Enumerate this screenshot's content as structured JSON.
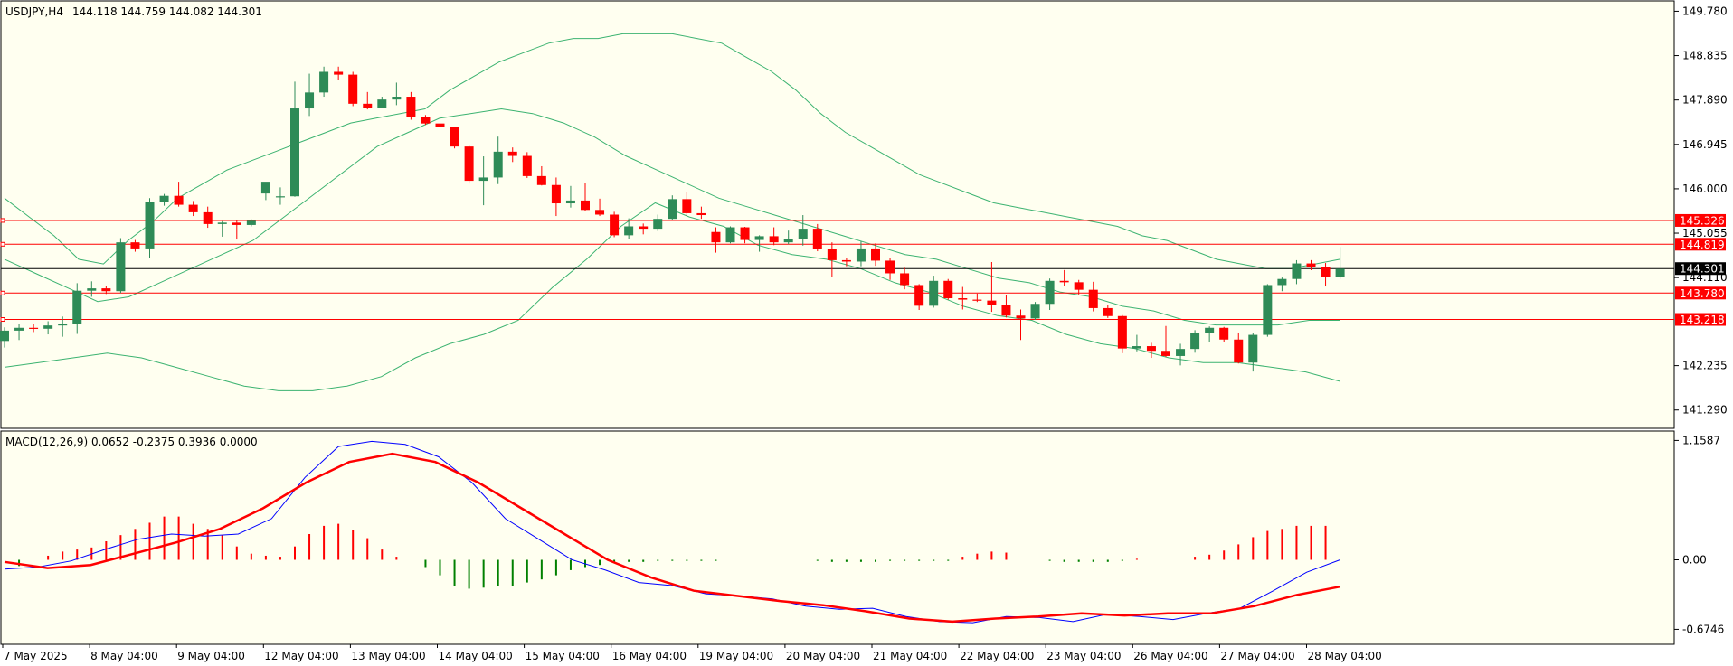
{
  "header": {
    "symbol": "USDJPY,H4",
    "ohlc": "144.118 144.759 144.082 144.301"
  },
  "macd_header": {
    "label": "MACD(12,26,9) 0.0652 -0.2375 0.3936 0.0000"
  },
  "colors": {
    "background": "#fffff0",
    "bull": "#2e8b57",
    "bear": "#ff0000",
    "band": "#3cb371",
    "hline": "#ff0000",
    "price_line": "#000000",
    "macd_line": "#0000ff",
    "signal_line": "#ff0000",
    "hist_pos": "#ff0000",
    "hist_neg": "#008000"
  },
  "chart_data": [
    {
      "type": "candlestick",
      "title": "USDJPY,H4",
      "ylim": [
        140.9,
        150.0
      ],
      "y_ticks": [
        "149.780",
        "148.835",
        "147.890",
        "146.945",
        "146.000",
        "145.055",
        "144.110",
        "142.235",
        "141.290"
      ],
      "x_ticks": [
        "7 May 2025",
        "8 May 04:00",
        "9 May 04:00",
        "12 May 04:00",
        "13 May 04:00",
        "14 May 04:00",
        "15 May 04:00",
        "16 May 04:00",
        "19 May 04:00",
        "20 May 04:00",
        "21 May 04:00",
        "22 May 04:00",
        "23 May 04:00",
        "26 May 04:00",
        "27 May 04:00",
        "28 May 04:00"
      ],
      "horizontal_levels": [
        {
          "value": 145.326,
          "label": "145.326"
        },
        {
          "value": 144.819,
          "label": "144.819"
        },
        {
          "value": 143.78,
          "label": "143.780"
        },
        {
          "value": 143.218,
          "label": "143.218"
        }
      ],
      "current_price": {
        "value": 144.301,
        "label": "144.301"
      },
      "candles": [
        [
          142.76,
          143.05,
          142.62,
          142.98
        ],
        [
          142.98,
          143.13,
          142.78,
          143.04
        ],
        [
          143.04,
          143.12,
          142.95,
          143.02
        ],
        [
          143.02,
          143.18,
          142.9,
          143.09
        ],
        [
          143.09,
          143.28,
          142.85,
          143.12
        ],
        [
          143.12,
          143.99,
          142.91,
          143.83
        ],
        [
          143.83,
          144.03,
          143.7,
          143.88
        ],
        [
          143.88,
          143.93,
          143.76,
          143.82
        ],
        [
          143.82,
          144.95,
          143.78,
          144.86
        ],
        [
          144.86,
          144.91,
          144.66,
          144.73
        ],
        [
          144.73,
          145.8,
          144.53,
          145.72
        ],
        [
          145.72,
          145.89,
          145.64,
          145.85
        ],
        [
          145.85,
          146.15,
          145.62,
          145.66
        ],
        [
          145.66,
          145.74,
          145.42,
          145.5
        ],
        [
          145.5,
          145.62,
          145.17,
          145.25
        ],
        [
          145.25,
          145.31,
          144.98,
          145.28
        ],
        [
          145.28,
          145.34,
          144.92,
          145.23
        ],
        [
          145.23,
          145.35,
          145.2,
          145.32
        ],
        [
          145.9,
          146.08,
          145.76,
          146.15
        ],
        [
          145.82,
          146.03,
          145.66,
          145.84
        ],
        [
          145.84,
          148.28,
          145.83,
          147.71
        ],
        [
          147.71,
          148.45,
          147.55,
          148.05
        ],
        [
          148.05,
          148.6,
          147.96,
          148.49
        ],
        [
          148.49,
          148.6,
          148.32,
          148.43
        ],
        [
          148.43,
          148.49,
          147.76,
          147.81
        ],
        [
          147.81,
          148.06,
          147.69,
          147.72
        ],
        [
          147.72,
          147.96,
          147.72,
          147.9
        ],
        [
          147.9,
          148.26,
          147.78,
          147.96
        ],
        [
          147.96,
          148.06,
          147.47,
          147.52
        ],
        [
          147.52,
          147.57,
          147.36,
          147.39
        ],
        [
          147.39,
          147.5,
          147.28,
          147.31
        ],
        [
          147.31,
          147.32,
          146.86,
          146.9
        ],
        [
          146.9,
          146.94,
          146.11,
          146.17
        ],
        [
          146.17,
          146.69,
          145.65,
          146.24
        ],
        [
          146.24,
          147.11,
          146.1,
          146.79
        ],
        [
          146.79,
          146.88,
          146.57,
          146.7
        ],
        [
          146.7,
          146.78,
          146.23,
          146.27
        ],
        [
          146.27,
          146.48,
          146.07,
          146.08
        ],
        [
          146.08,
          146.24,
          145.42,
          145.69
        ],
        [
          145.69,
          146.06,
          145.6,
          145.75
        ],
        [
          145.75,
          146.12,
          145.53,
          145.55
        ],
        [
          145.55,
          145.79,
          145.42,
          145.45
        ],
        [
          145.45,
          145.51,
          144.97,
          145.01
        ],
        [
          145.01,
          145.37,
          144.94,
          145.2
        ],
        [
          145.2,
          145.26,
          145.03,
          145.15
        ],
        [
          145.15,
          145.45,
          145.1,
          145.36
        ],
        [
          145.36,
          145.86,
          145.33,
          145.78
        ],
        [
          145.78,
          145.94,
          145.42,
          145.48
        ],
        [
          145.48,
          145.62,
          145.36,
          145.44
        ],
        [
          145.08,
          145.18,
          144.64,
          144.86
        ],
        [
          144.86,
          145.2,
          144.84,
          145.18
        ],
        [
          145.18,
          145.19,
          144.84,
          144.91
        ],
        [
          144.91,
          145.01,
          144.66,
          144.99
        ],
        [
          144.99,
          145.18,
          144.8,
          144.86
        ],
        [
          144.86,
          145.11,
          144.82,
          144.94
        ],
        [
          144.94,
          145.44,
          144.79,
          145.15
        ],
        [
          145.15,
          145.25,
          144.67,
          144.71
        ],
        [
          144.71,
          144.86,
          144.12,
          144.48
        ],
        [
          144.48,
          144.52,
          144.35,
          144.45
        ],
        [
          144.45,
          144.88,
          144.35,
          144.73
        ],
        [
          144.73,
          144.84,
          144.36,
          144.47
        ],
        [
          144.47,
          144.52,
          144.06,
          144.2
        ],
        [
          144.2,
          144.32,
          143.86,
          143.95
        ],
        [
          143.95,
          143.97,
          143.42,
          143.51
        ],
        [
          143.51,
          144.15,
          143.47,
          144.04
        ],
        [
          144.04,
          144.08,
          143.64,
          143.67
        ],
        [
          143.67,
          143.91,
          143.43,
          143.64
        ],
        [
          143.64,
          143.77,
          143.59,
          143.62
        ],
        [
          143.62,
          144.44,
          143.38,
          143.53
        ],
        [
          143.53,
          143.73,
          143.26,
          143.3
        ],
        [
          143.3,
          143.43,
          142.78,
          143.24
        ],
        [
          143.24,
          143.59,
          143.21,
          143.55
        ],
        [
          143.55,
          144.09,
          143.42,
          144.04
        ],
        [
          144.04,
          144.27,
          143.93,
          144.01
        ],
        [
          144.01,
          144.06,
          143.75,
          143.85
        ],
        [
          143.85,
          144.02,
          143.39,
          143.46
        ],
        [
          143.46,
          143.53,
          143.25,
          143.29
        ],
        [
          143.29,
          143.31,
          142.5,
          142.6
        ],
        [
          142.6,
          142.89,
          142.54,
          142.65
        ],
        [
          142.65,
          142.72,
          142.4,
          142.55
        ],
        [
          142.55,
          143.08,
          142.42,
          142.44
        ],
        [
          142.44,
          142.7,
          142.24,
          142.59
        ],
        [
          142.59,
          142.99,
          142.51,
          142.92
        ],
        [
          142.92,
          143.07,
          142.73,
          143.04
        ],
        [
          143.04,
          143.06,
          142.73,
          142.79
        ],
        [
          142.79,
          142.94,
          142.28,
          142.3
        ],
        [
          142.3,
          142.93,
          142.11,
          142.89
        ],
        [
          142.89,
          143.97,
          142.85,
          143.95
        ],
        [
          143.95,
          144.11,
          143.82,
          144.08
        ],
        [
          144.08,
          144.48,
          143.97,
          144.41
        ],
        [
          144.41,
          144.48,
          144.27,
          144.34
        ],
        [
          144.34,
          144.42,
          143.92,
          144.12
        ],
        [
          144.12,
          144.76,
          144.08,
          144.3
        ]
      ],
      "bollinger": {
        "upper": [
          145.8,
          145.4,
          145.0,
          144.5,
          144.4,
          144.9,
          145.3,
          145.8,
          146.1,
          146.4,
          146.6,
          146.8,
          147.0,
          147.2,
          147.4,
          147.5,
          147.6,
          147.7,
          148.1,
          148.4,
          148.7,
          148.9,
          149.1,
          149.2,
          149.2,
          149.3,
          149.3,
          149.3,
          149.2,
          149.1,
          148.8,
          148.5,
          148.1,
          147.6,
          147.2,
          146.9,
          146.6,
          146.3,
          146.1,
          145.9,
          145.7,
          145.6,
          145.5,
          145.4,
          145.3,
          145.2,
          145.0,
          144.9,
          144.7,
          144.5,
          144.4,
          144.3,
          144.3,
          144.4,
          144.5
        ],
        "middle": [
          144.5,
          144.2,
          143.9,
          143.6,
          143.7,
          144.0,
          144.3,
          144.6,
          144.9,
          145.4,
          145.9,
          146.4,
          146.9,
          147.2,
          147.5,
          147.6,
          147.7,
          147.6,
          147.4,
          147.1,
          146.7,
          146.4,
          146.1,
          145.8,
          145.6,
          145.4,
          145.2,
          145.0,
          144.8,
          144.6,
          144.5,
          144.3,
          144.1,
          144.0,
          143.8,
          143.7,
          143.5,
          143.4,
          143.2,
          143.1,
          143.1,
          143.1,
          143.2,
          143.2
        ],
        "lower": [
          142.2,
          142.3,
          142.4,
          142.5,
          142.4,
          142.2,
          142.0,
          141.8,
          141.7,
          141.7,
          141.8,
          142.0,
          142.4,
          142.7,
          142.9,
          143.2,
          143.9,
          144.5,
          145.2,
          145.7,
          145.4,
          145.2,
          144.8,
          144.6,
          144.5,
          144.3,
          144.0,
          143.8,
          143.5,
          143.3,
          143.2,
          142.9,
          142.7,
          142.6,
          142.4,
          142.3,
          142.3,
          142.2,
          142.1,
          141.9
        ]
      }
    },
    {
      "type": "macd",
      "title": "MACD(12,26,9) 0.0652 -0.2375 0.3936 0.0000",
      "ylim": [
        -0.82,
        1.25
      ],
      "y_ticks": [
        "1.1587",
        "0.00",
        "-0.6746"
      ],
      "histogram": [
        0.0,
        -0.06,
        0.0,
        0.04,
        0.08,
        0.1,
        0.12,
        0.18,
        0.24,
        0.3,
        0.36,
        0.42,
        0.42,
        0.35,
        0.3,
        0.24,
        0.13,
        0.06,
        0.04,
        0.03,
        0.13,
        0.25,
        0.33,
        0.35,
        0.29,
        0.21,
        0.1,
        0.03,
        0.0,
        -0.07,
        -0.15,
        -0.25,
        -0.28,
        -0.27,
        -0.25,
        -0.25,
        -0.22,
        -0.19,
        -0.15,
        -0.1,
        -0.07,
        -0.05,
        -0.02,
        -0.02,
        -0.02,
        -0.01,
        -0.01,
        -0.01,
        -0.01,
        -0.01,
        0.0,
        0.0,
        0.0,
        0.0,
        0.0,
        0.0,
        -0.01,
        -0.02,
        -0.02,
        -0.02,
        -0.02,
        -0.01,
        -0.01,
        -0.01,
        -0.01,
        -0.01,
        0.03,
        0.06,
        0.08,
        0.07,
        0.0,
        0.0,
        -0.01,
        -0.02,
        -0.02,
        -0.02,
        -0.02,
        -0.01,
        0.01,
        0.0,
        0.0,
        0.0,
        0.03,
        0.05,
        0.09,
        0.15,
        0.22,
        0.28,
        0.3,
        0.33,
        0.33,
        0.33
      ],
      "macd": [
        -0.09,
        -0.07,
        -0.01,
        0.1,
        0.2,
        0.25,
        0.23,
        0.25,
        0.4,
        0.8,
        1.1,
        1.15,
        1.12,
        1.0,
        0.75,
        0.4,
        0.2,
        0.0,
        -0.1,
        -0.22,
        -0.25,
        -0.33,
        -0.35,
        -0.38,
        -0.45,
        -0.48,
        -0.47,
        -0.55,
        -0.6,
        -0.61,
        -0.55,
        -0.56,
        -0.6,
        -0.53,
        -0.55,
        -0.58,
        -0.52,
        -0.47,
        -0.3,
        -0.12,
        0.0
      ],
      "signal": [
        -0.02,
        -0.08,
        -0.05,
        0.06,
        0.17,
        0.3,
        0.5,
        0.75,
        0.95,
        1.03,
        0.95,
        0.75,
        0.5,
        0.25,
        0.0,
        -0.17,
        -0.3,
        -0.35,
        -0.4,
        -0.44,
        -0.5,
        -0.57,
        -0.6,
        -0.57,
        -0.55,
        -0.52,
        -0.54,
        -0.52,
        -0.52,
        -0.45,
        -0.34,
        -0.26
      ]
    }
  ]
}
